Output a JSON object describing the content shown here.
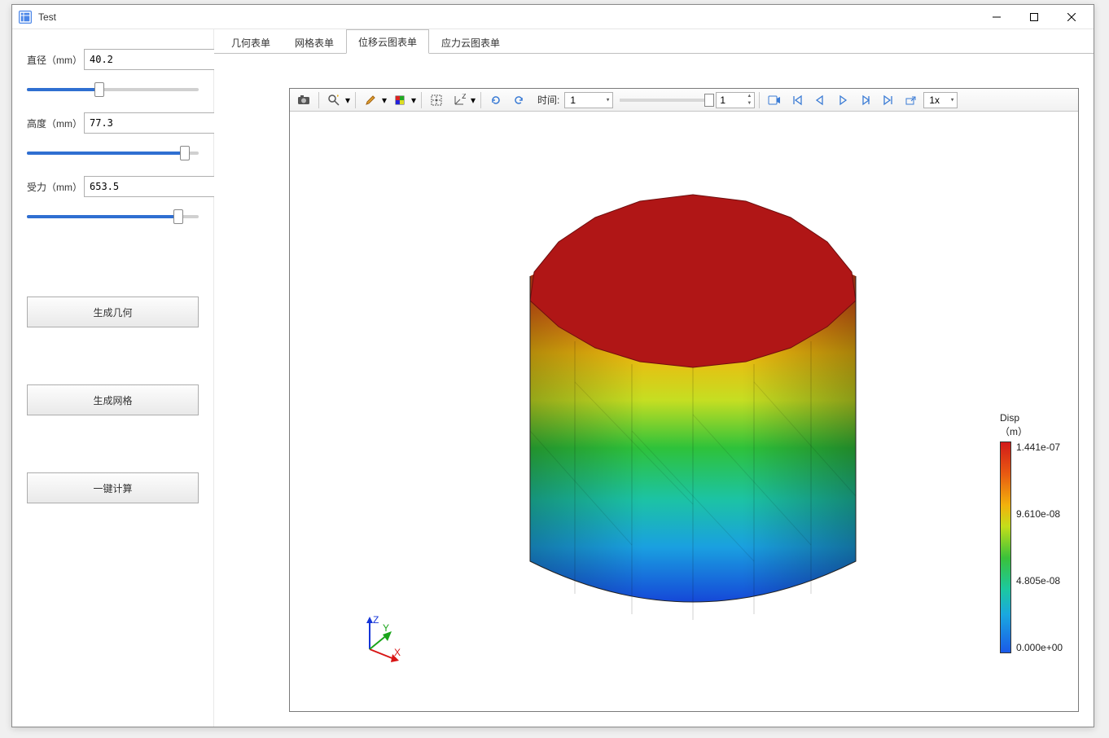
{
  "window": {
    "title": "Test"
  },
  "params": {
    "diameter": {
      "label": "直径（mm）",
      "value": "40.2",
      "slider_pct": 42
    },
    "height": {
      "label": "高度（mm）",
      "value": "77.3",
      "slider_pct": 92
    },
    "force": {
      "label": "受力（mm）",
      "value": "653.5",
      "slider_pct": 88
    }
  },
  "buttons": {
    "gen_geom": "生成几何",
    "gen_mesh": "生成网格",
    "compute": "一键计算"
  },
  "tabs": {
    "items": [
      "几何表单",
      "网格表单",
      "位移云图表单",
      "应力云图表单"
    ],
    "active_index": 2
  },
  "toolbar": {
    "time_label": "时间:",
    "time_value": "1",
    "frame_value": "1",
    "speed_value": "1x"
  },
  "legend": {
    "title_line1": "Disp",
    "title_line2": "（m）",
    "ticks": [
      "1.441e-07",
      "9.610e-08",
      "4.805e-08",
      "0.000e+00"
    ]
  },
  "triad": {
    "x": "X",
    "y": "Y",
    "z": "Z"
  },
  "icons": {
    "camera": "camera-icon",
    "zoom": "zoom-icon",
    "brush": "brush-icon",
    "cube": "cube-icon",
    "fit": "fit-icon",
    "axes": "axes-icon",
    "refresh": "refresh-icon",
    "reset": "reset-icon",
    "rec": "record-icon",
    "first": "first-icon",
    "prev": "prev-icon",
    "play": "play-icon",
    "next": "next-icon",
    "last": "last-icon",
    "export": "export-icon"
  }
}
